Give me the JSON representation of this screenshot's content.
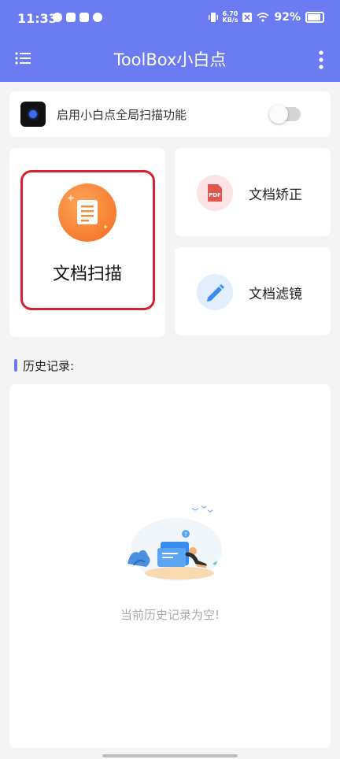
{
  "status": {
    "time": "11:33",
    "netspeed_value": "6.70",
    "netspeed_unit": "KB/s",
    "battery": "92%"
  },
  "appbar": {
    "title": "ToolBox小白点"
  },
  "global_scan": {
    "label": "启用小白点全局扫描功能",
    "enabled": false
  },
  "features": {
    "scan": "文档扫描",
    "correct": "文档矫正",
    "filter": "文档滤镜",
    "pdf_badge": "PDF"
  },
  "history": {
    "title": "历史记录:",
    "empty_text": "当前历史记录为空!"
  },
  "colors": {
    "primary": "#6b7cf3",
    "highlight": "#d8202e",
    "scan_orange": "#f26a1b"
  }
}
